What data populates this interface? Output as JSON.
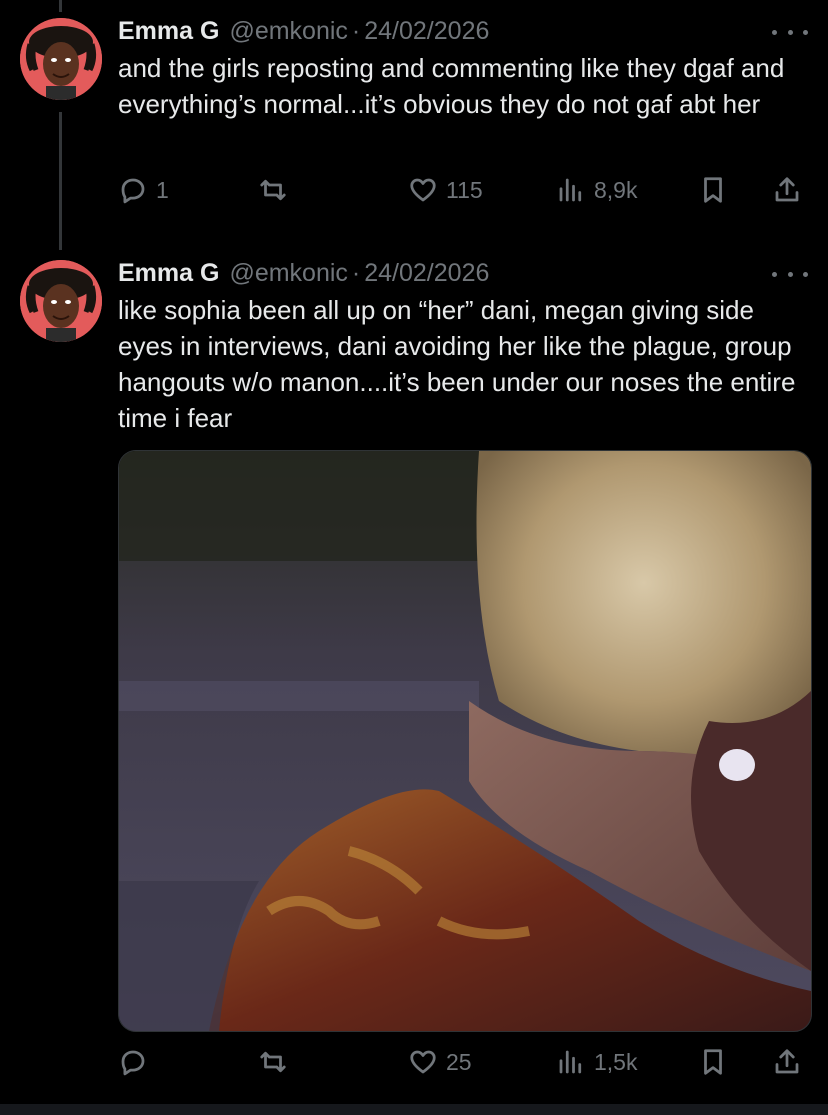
{
  "tweets": [
    {
      "name": "Emma G",
      "handle": "@emkonic",
      "separator": "·",
      "date": "24/02/2026",
      "text": "and the girls reposting and commenting like they dgaf and everything’s normal...it’s obvious they do not gaf abt her",
      "actions": {
        "replies": "1",
        "reposts": "",
        "likes": "115",
        "views": "8,9k"
      }
    },
    {
      "name": "Emma G",
      "handle": "@emkonic",
      "separator": "·",
      "date": "24/02/2026",
      "text": "like sophia been all up on “her” dani, megan giving side eyes in interviews, dani avoiding her like the plague, group hangouts w/o manon....it’s been under our noses the entire time i fear",
      "actions": {
        "replies": "",
        "reposts": "",
        "likes": "25",
        "views": "1,5k"
      }
    }
  ],
  "colors": {
    "background": "#000000",
    "text": "#e7e9ea",
    "muted": "#71767b",
    "avatar_bg": "#e35b5b"
  },
  "icons": [
    "reply-icon",
    "repost-icon",
    "like-icon",
    "views-icon",
    "bookmark-icon",
    "share-icon",
    "more-icon"
  ]
}
